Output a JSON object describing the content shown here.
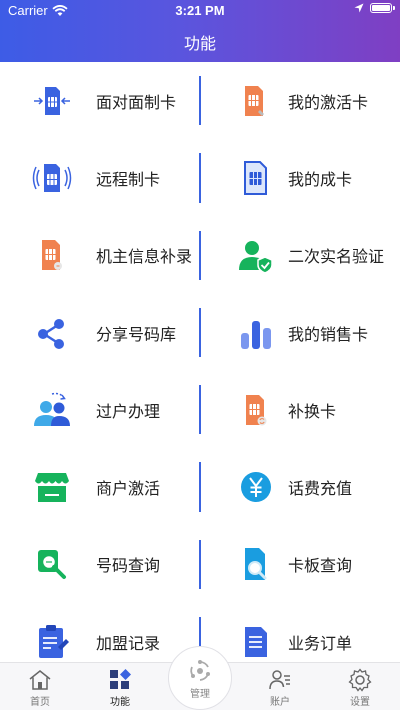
{
  "status": {
    "carrier": "Carrier",
    "time": "3:21 PM"
  },
  "header": {
    "title": "功能"
  },
  "rows": [
    {
      "left": {
        "label": "面对面制卡",
        "icon": "face-to-face-card-icon"
      },
      "right": {
        "label": "我的激活卡",
        "icon": "my-activated-card-icon"
      }
    },
    {
      "left": {
        "label": "远程制卡",
        "icon": "remote-card-icon"
      },
      "right": {
        "label": "我的成卡",
        "icon": "my-finished-card-icon"
      }
    },
    {
      "left": {
        "label": "机主信息补录",
        "icon": "owner-info-icon"
      },
      "right": {
        "label": "二次实名验证",
        "icon": "realname-verify-icon"
      }
    },
    {
      "left": {
        "label": "分享号码库",
        "icon": "share-icon"
      },
      "right": {
        "label": "我的销售卡",
        "icon": "sales-chart-icon"
      }
    },
    {
      "left": {
        "label": "过户办理",
        "icon": "transfer-users-icon"
      },
      "right": {
        "label": "补换卡",
        "icon": "replace-card-icon"
      }
    },
    {
      "left": {
        "label": "商户激活",
        "icon": "shop-icon"
      },
      "right": {
        "label": "话费充值",
        "icon": "yen-recharge-icon"
      }
    },
    {
      "left": {
        "label": "号码查询",
        "icon": "number-search-icon"
      },
      "right": {
        "label": "卡板查询",
        "icon": "card-search-icon"
      }
    },
    {
      "left": {
        "label": "加盟记录",
        "icon": "clipboard-icon"
      },
      "right": {
        "label": "业务订单",
        "icon": "order-document-icon"
      }
    }
  ],
  "tabs": {
    "home": "首页",
    "features": "功能",
    "manage": "管理",
    "account": "账户",
    "settings": "设置"
  },
  "colors": {
    "accent": "#3a63e0",
    "orange": "#f0824f",
    "green": "#16b35c",
    "gradient_start": "#3d5ce6",
    "gradient_end": "#7f3fc3"
  }
}
